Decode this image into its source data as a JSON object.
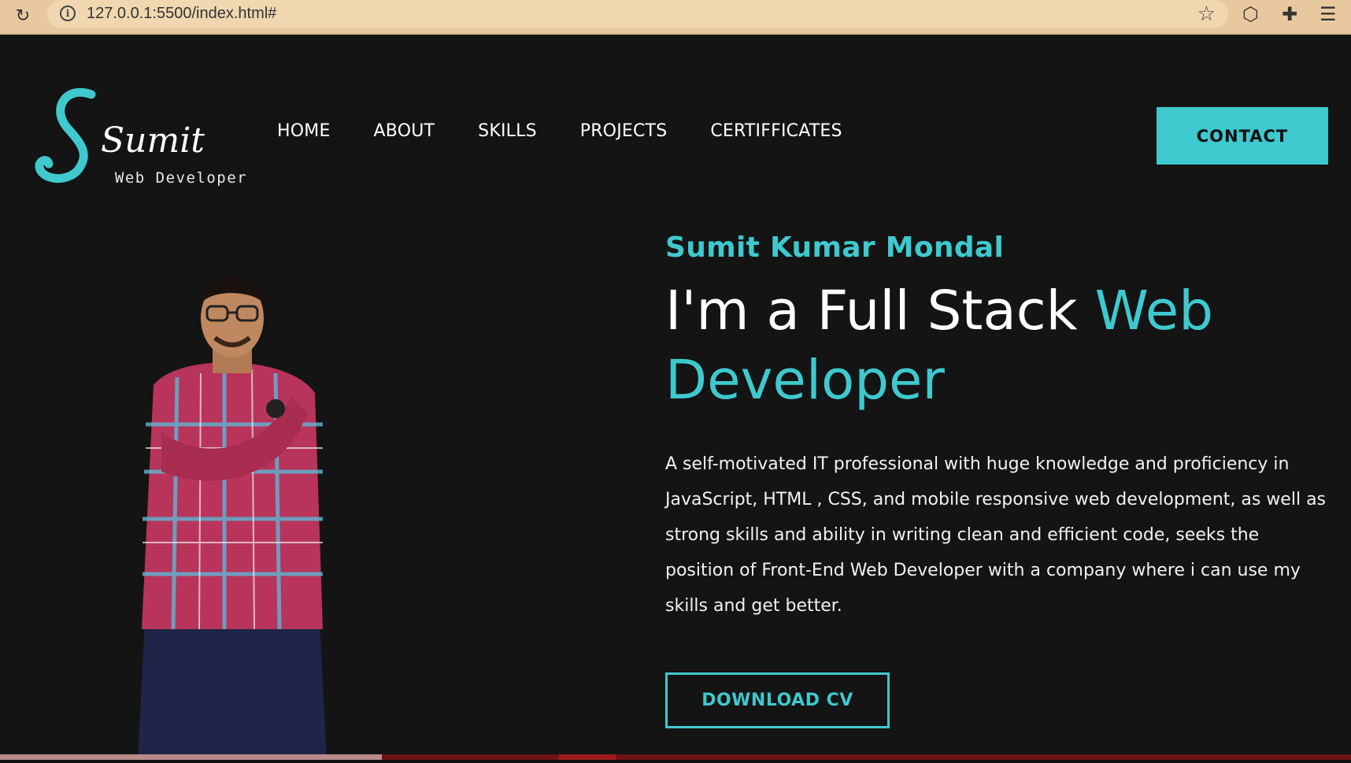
{
  "browser": {
    "url": "127.0.0.1:5500/index.html#"
  },
  "logo": {
    "letter": "S",
    "name": "Sumit",
    "tagline": "Web Developer"
  },
  "nav": {
    "items": [
      "HOME",
      "ABOUT",
      "SKILLS",
      "PROJECTS",
      "CERTIFFICATES"
    ],
    "contact_label": "CONTACT"
  },
  "hero": {
    "name": "Sumit Kumar Mondal",
    "title_prefix": "I'm a Full Stack ",
    "title_accent": "Web Developer",
    "description": "A self-motivated IT professional with huge knowledge and proficiency in JavaScript, HTML , CSS, and mobile responsive web development, as well as strong skills and ability in writing clean and efficient code, seeks the position of Front-End Web Developer with a company where i can use my skills and get better.",
    "download_label": "DOWNLOAD CV"
  },
  "colors": {
    "accent": "#3ec9ce",
    "background": "#141414",
    "browser_bar": "#e8c99f"
  }
}
